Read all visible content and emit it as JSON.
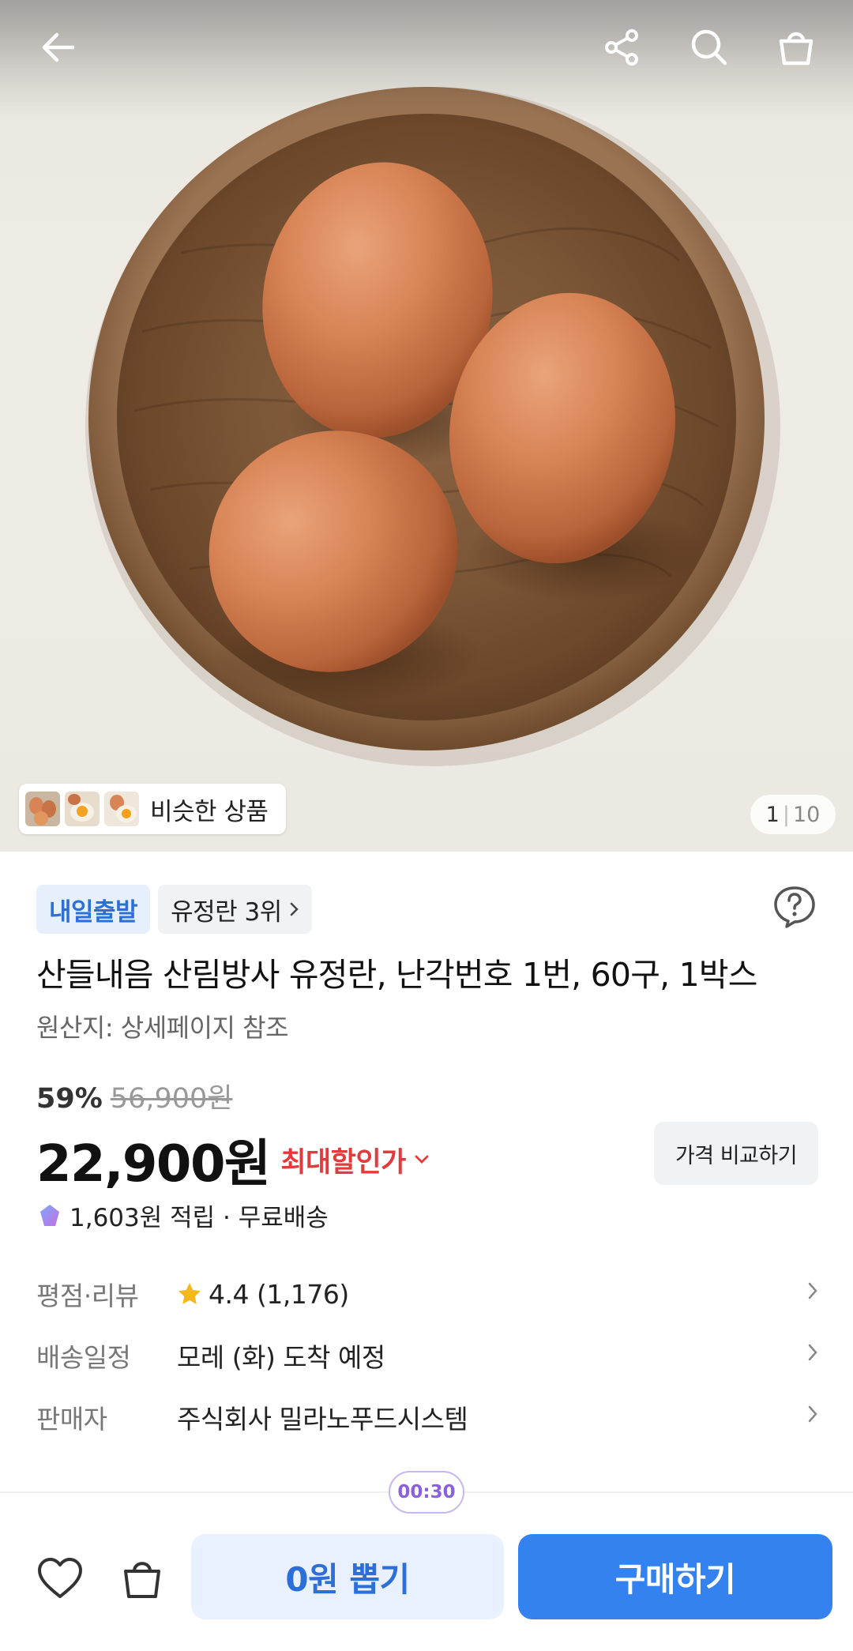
{
  "hero": {
    "similar_label": "비슷한 상품",
    "page_current": "1",
    "page_total": "10"
  },
  "icons": {
    "back": "arrow-left-icon",
    "share": "share-icon",
    "search": "search-icon",
    "cart": "shopping-bag-icon",
    "help": "help-question-icon"
  },
  "product": {
    "badge_delivery": "내일출발",
    "badge_rank": "유정란 3위",
    "title": "산들내음 산림방사 유정란, 난각번호 1번, 60구, 1박스",
    "origin": "원산지: 상세페이지 참조",
    "discount_pct": "59%",
    "original_price": "56,900원",
    "price": "22,900원",
    "max_discount": "최대할인가",
    "compare_label": "가격 비교하기",
    "reward": "1,603원 적립 · 무료배송"
  },
  "info": {
    "rating_label": "평점·리뷰",
    "rating_value": "4.4 (1,176)",
    "delivery_label": "배송일정",
    "delivery_value": "모레 (화) 도착 예정",
    "seller_label": "판매자",
    "seller_value": "주식회사 밀라노푸드시스템"
  },
  "bottom": {
    "timer": "00:30",
    "draw_label": "0원 뽑기",
    "buy_label": "구매하기"
  },
  "colors": {
    "accent_blue": "#3482f0",
    "badge_blue_text": "#2d6fd8",
    "discount_red": "#e33b3b",
    "star_yellow": "#f5b81c",
    "timer_purple": "#8a5fe0"
  }
}
